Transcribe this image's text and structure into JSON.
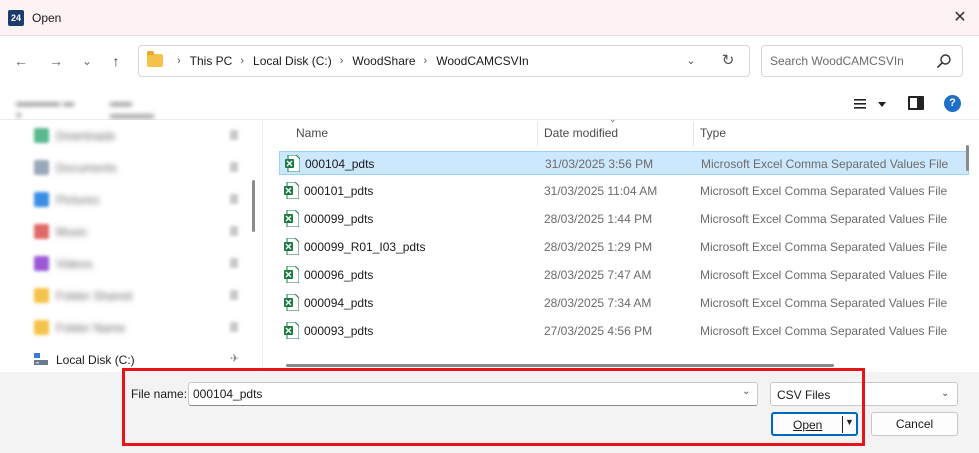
{
  "window": {
    "title": "Open",
    "app_icon_text": "24",
    "close_symbol": "✕"
  },
  "nav": {
    "back_symbol": "←",
    "forward_symbol": "→",
    "recent_symbol": "⌄",
    "up_symbol": "↑",
    "breadcrumbs": [
      "This PC",
      "Local Disk (C:)",
      "WoodShare",
      "WoodCAMCSVIn"
    ],
    "refresh_symbol": "↻",
    "dropdown_symbol": "⌄",
    "search_placeholder": "Search WoodCAMCSVIn"
  },
  "commandbar": {
    "help_symbol": "?"
  },
  "sidebar": {
    "items": [
      {
        "icon_color": "#59b98f",
        "blurred": true
      },
      {
        "icon_color": "#9aa7b8",
        "blurred": true
      },
      {
        "icon_color": "#3a8ee6",
        "blurred": true
      },
      {
        "icon_color": "#e06868",
        "blurred": true
      },
      {
        "icon_color": "#9b59d6",
        "blurred": true
      },
      {
        "icon_color": "#f6c34a",
        "blurred": true
      },
      {
        "icon_color": "#f6c34a",
        "blurred": true
      }
    ],
    "local_disk_label": "Local Disk (C:)",
    "pin_symbol": "📌"
  },
  "filelist": {
    "columns": {
      "name": "Name",
      "date": "Date modified",
      "type": "Type"
    },
    "rows": [
      {
        "name": "000104_pdts",
        "date": "31/03/2025 3:56 PM",
        "type": "Microsoft Excel Comma Separated Values File",
        "selected": true
      },
      {
        "name": "000101_pdts",
        "date": "31/03/2025 11:04 AM",
        "type": "Microsoft Excel Comma Separated Values File",
        "selected": false
      },
      {
        "name": "000099_pdts",
        "date": "28/03/2025 1:44 PM",
        "type": "Microsoft Excel Comma Separated Values File",
        "selected": false
      },
      {
        "name": "000099_R01_I03_pdts",
        "date": "28/03/2025 1:29 PM",
        "type": "Microsoft Excel Comma Separated Values File",
        "selected": false
      },
      {
        "name": "000096_pdts",
        "date": "28/03/2025 7:47 AM",
        "type": "Microsoft Excel Comma Separated Values File",
        "selected": false
      },
      {
        "name": "000094_pdts",
        "date": "28/03/2025 7:34 AM",
        "type": "Microsoft Excel Comma Separated Values File",
        "selected": false
      },
      {
        "name": "000093_pdts",
        "date": "27/03/2025 4:56 PM",
        "type": "Microsoft Excel Comma Separated Values File",
        "selected": false
      }
    ]
  },
  "bottom": {
    "file_name_label": "File name:",
    "file_name_value": "000104_pdts",
    "file_type_value": "CSV Files",
    "open_label": "Open",
    "cancel_label": "Cancel"
  },
  "colors": {
    "selection_bg": "#cce8ff",
    "accent": "#0067c0",
    "highlight_frame": "#e8141b",
    "excel_green": "#1d7a45"
  }
}
